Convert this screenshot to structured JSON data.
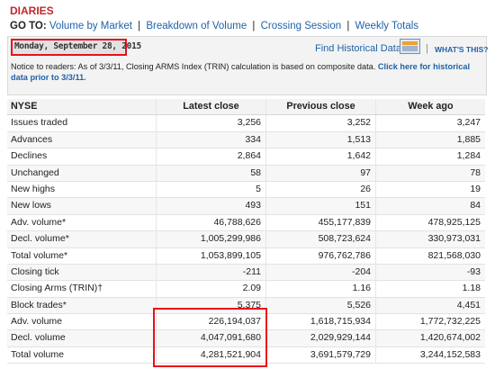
{
  "title": "DIARIES",
  "goto": {
    "label": "GO TO:",
    "links": [
      "Volume by Market",
      "Breakdown of Volume",
      "Crossing Session",
      "Weekly Totals"
    ],
    "separator": "|"
  },
  "date": "Monday, September 28, 2015",
  "historical": {
    "link": "Find Historical Data",
    "separator": "|",
    "whats_this": "WHAT'S THIS?"
  },
  "notice": {
    "text": "Notice to readers: As of 3/3/11, Closing ARMS Index (TRIN) calculation is based on composite data.",
    "link": "Click here for historical data prior to 3/3/11."
  },
  "table": {
    "headers": [
      "NYSE",
      "Latest close",
      "Previous close",
      "Week ago"
    ],
    "rows": [
      [
        "Issues traded",
        "3,256",
        "3,252",
        "3,247"
      ],
      [
        "Advances",
        "334",
        "1,513",
        "1,885"
      ],
      [
        "Declines",
        "2,864",
        "1,642",
        "1,284"
      ],
      [
        "Unchanged",
        "58",
        "97",
        "78"
      ],
      [
        "New highs",
        "5",
        "26",
        "19"
      ],
      [
        "New lows",
        "493",
        "151",
        "84"
      ],
      [
        "Adv. volume*",
        "46,788,626",
        "455,177,839",
        "478,925,125"
      ],
      [
        "Decl. volume*",
        "1,005,299,986",
        "508,723,624",
        "330,973,031"
      ],
      [
        "Total volume*",
        "1,053,899,105",
        "976,762,786",
        "821,568,030"
      ],
      [
        "Closing tick",
        "-211",
        "-204",
        "-93"
      ],
      [
        "Closing Arms (TRIN)†",
        "2.09",
        "1.16",
        "1.18"
      ],
      [
        "Block trades*",
        "5,375",
        "5,526",
        "4,451"
      ],
      [
        "Adv. volume",
        "226,194,037",
        "1,618,715,934",
        "1,772,732,225"
      ],
      [
        "Decl. volume",
        "4,047,091,680",
        "2,029,929,144",
        "1,420,674,002"
      ],
      [
        "Total volume",
        "4,281,521,904",
        "3,691,579,729",
        "3,244,152,583"
      ]
    ]
  },
  "colors": {
    "accent": "#c1272d",
    "link": "#1f62a8",
    "highlight": "#e8111a"
  }
}
